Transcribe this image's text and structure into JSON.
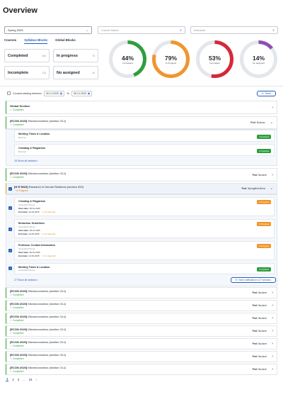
{
  "header": {
    "title": "Overview"
  },
  "filters": {
    "semester": "Spring 2025",
    "course_placeholder": "Course Name",
    "instructor_placeholder": "Instructor"
  },
  "tabs": [
    {
      "label": "Courses"
    },
    {
      "label": "Syllabus Blocks",
      "active": true
    },
    {
      "label": "Global Blocks"
    }
  ],
  "stats": [
    {
      "label": "Completed",
      "count": "334"
    },
    {
      "label": "In progress",
      "count": "73"
    },
    {
      "label": "Incomplete",
      "count": "113"
    },
    {
      "label": "No assigned",
      "count": "10"
    }
  ],
  "donuts": [
    {
      "percent": 44,
      "label": "Completed",
      "color": "#2e9e3e"
    },
    {
      "percent": 79,
      "label": "In Progress",
      "color": "#f0962d"
    },
    {
      "percent": 53,
      "label": "Incomplete",
      "color": "#d62839"
    },
    {
      "percent": 14,
      "label": "No assigned",
      "color": "#8e4fb5"
    }
  ],
  "date_filter": {
    "label": "Courses starting between",
    "from": "06.14.2025",
    "to_label": "To",
    "to": "06.14.2025",
    "send": "Send"
  },
  "rows": {
    "global": {
      "title": "Global Section",
      "status": "Completed"
    },
    "econ_1": {
      "code": "[ECON 2020]",
      "name": "Microeconomics (section OL1)",
      "status": "Completed",
      "prof_label": "Prof.",
      "prof": "Buckner"
    },
    "hrb": {
      "code": "[H R 5023]",
      "name": "Research in Human Relations (section 493)",
      "status": "In Progress",
      "prof_label": "Prof.",
      "prof": "Springfield Mona"
    },
    "econ_2": {
      "code": "[ECON 2020]",
      "name": "Microeconomics (section OL1)",
      "status": "Completed",
      "prof_label": "Prof.",
      "prof": "Buckner"
    },
    "econ_list": [
      {
        "code": "[ECON 2020]",
        "name": "Microeconomics (section OL1)",
        "status": "Completed",
        "prof_label": "Prof.",
        "prof": "Buckner"
      },
      {
        "code": "[ECON 2020]",
        "name": "Microeconomics (section OL1)",
        "status": "Completed",
        "prof_label": "Prof.",
        "prof": "Buckner"
      },
      {
        "code": "[ECON 2020]",
        "name": "Microeconomics (section OL1)",
        "status": "Completed",
        "prof_label": "Prof.",
        "prof": "Buckner"
      },
      {
        "code": "[ECON 2020]",
        "name": "Microeconomics (section OL1)",
        "status": "Completed",
        "prof_label": "Prof.",
        "prof": "Buckner"
      },
      {
        "code": "[ECON 2020]",
        "name": "Microeconomics (section OL1)",
        "status": "Completed",
        "prof_label": "Prof.",
        "prof": "Buckner"
      },
      {
        "code": "[ECON 2020]",
        "name": "Microeconomics (section OL1)",
        "status": "Completed",
        "prof_label": "Prof.",
        "prof": "Buckner"
      },
      {
        "code": "[ECON 2020]",
        "name": "Microeconomics (section OL1)",
        "status": "Completed",
        "prof_label": "Prof.",
        "prof": "Buckner"
      }
    ]
  },
  "econ_sections": [
    {
      "title": "Meeting Times & Location",
      "name": "Buckner",
      "status": "Completed"
    },
    {
      "title": "Cheating & Plagiarism",
      "name": "Buckner",
      "status": "Completed"
    }
  ],
  "econ_show_all": "18 Show all sections",
  "hrb_sections": [
    {
      "title": "Cheating & Plagiarism",
      "name": "Springfield Mona",
      "start_label": "Start date:",
      "start": "05.01.2025",
      "end_label": "End date:",
      "end": "12.09.2025",
      "days": "10 days left",
      "status": "In Progress"
    },
    {
      "title": "Behaviour Guidelines",
      "name": "Springfield Mona",
      "start_label": "Start date:",
      "start": "05.01.2025",
      "end_label": "End date:",
      "end": "12.09.2025",
      "days": "10 days left",
      "status": "In Progress"
    },
    {
      "title": "Professor Contact Information",
      "name": "Springfield Mona",
      "start_label": "Start date:",
      "start": "05.01.2025",
      "end_label": "End date:",
      "end": "12.09.2025",
      "days": "10 days left",
      "status": "In Progress"
    },
    {
      "title": "Meeting Times & Location",
      "name": "Springfield Mona",
      "status": "Completed"
    }
  ],
  "hrb_show_all": "27 Show all sections",
  "hrb_notify": "Send notification to 27 sections",
  "pagination": {
    "pages": [
      "1",
      "2",
      "3",
      "...",
      "24"
    ],
    "next": "›"
  }
}
